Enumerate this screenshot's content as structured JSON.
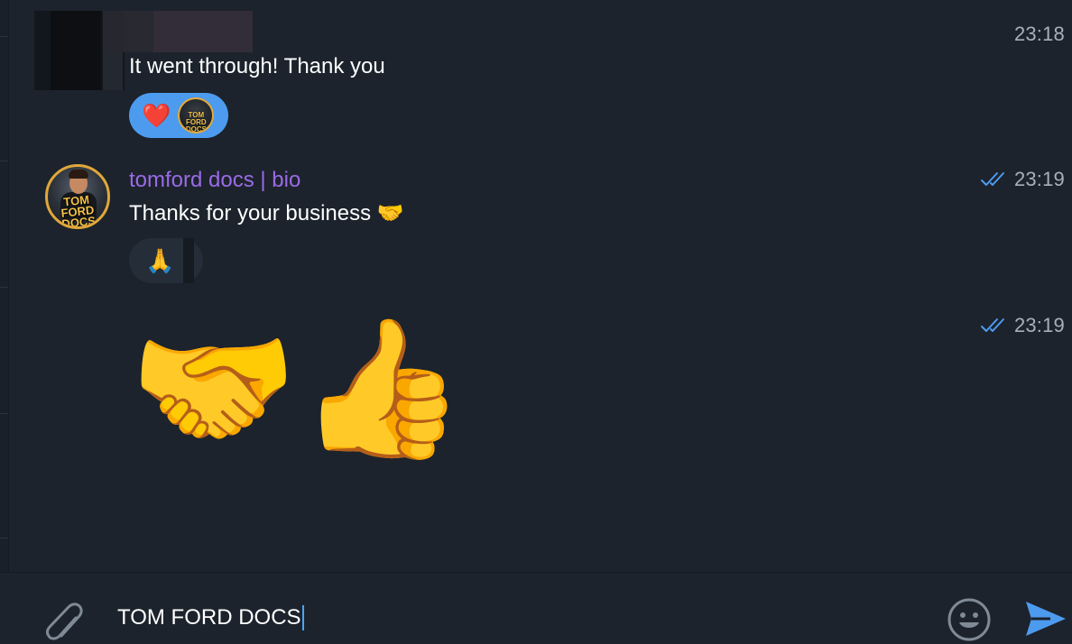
{
  "messages": [
    {
      "text": "It went through! Thank you",
      "time": "23:18",
      "reactions": [
        {
          "emoji": "❤️",
          "active": true,
          "reactor_avatar_text": "TOM FORD DOCS"
        }
      ]
    },
    {
      "sender": "tomford docs | bio",
      "avatar_text": "TOM FORD DOCS",
      "text": "Thanks for your business 🤝",
      "time": "23:19",
      "read_status": "double-check",
      "reactions": [
        {
          "emoji": "🙏",
          "active": false
        }
      ]
    },
    {
      "emojis": "🤝👍",
      "time": "23:19",
      "read_status": "double-check"
    }
  ],
  "composer": {
    "value": "TOM FORD DOCS",
    "attach_icon": "paperclip-icon",
    "emoji_icon": "smiley-icon",
    "send_icon": "send-arrow-icon"
  },
  "colors": {
    "background": "#1c232c",
    "sender_name": "#9b6ae8",
    "accent": "#4d9bef",
    "time": "#a7b0bb"
  }
}
